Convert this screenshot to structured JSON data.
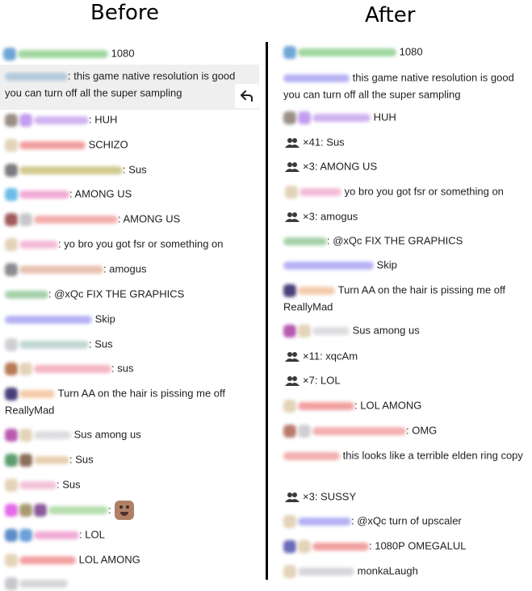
{
  "headings": {
    "before": "Before",
    "after": "After"
  },
  "colors": {
    "highlight": "#efefef",
    "divider": "#000000"
  },
  "icons": {
    "reply": "reply-arrow-icon",
    "group": "chatters-group-icon",
    "emote": "emote-face-icon"
  },
  "before": {
    "messages": [
      {
        "text": "1080"
      },
      {
        "text": ": this game native resolution is good you can turn off all the super sampling"
      },
      {
        "text": ": HUH"
      },
      {
        "text": "SCHIZO"
      },
      {
        "text": ": Sus"
      },
      {
        "text": ": AMONG US"
      },
      {
        "text": ": AMONG US"
      },
      {
        "text": ": yo bro you got fsr or something on"
      },
      {
        "text": ": amogus"
      },
      {
        "text": ": @xQc FIX THE GRAPHICS"
      },
      {
        "text": "Skip"
      },
      {
        "text": ": Sus"
      },
      {
        "text": ": sus"
      },
      {
        "text": "Turn AA on the hair is pissing me off ReallyMad"
      },
      {
        "text": "Sus among us"
      },
      {
        "text": ": Sus"
      },
      {
        "text": ": Sus"
      },
      {
        "text": ":"
      },
      {
        "text": ": LOL"
      },
      {
        "text": "LOL AMONG"
      }
    ]
  },
  "after": {
    "messages": [
      {
        "text": "1080"
      },
      {
        "text": "this game native resolution is good you can turn off all the super sampling"
      },
      {
        "text": "HUH"
      },
      {
        "text": "×41: Sus"
      },
      {
        "text": "×3: AMONG US"
      },
      {
        "text": "yo bro you got fsr or something on"
      },
      {
        "text": "×3: amogus"
      },
      {
        "text": ": @xQc FIX THE GRAPHICS"
      },
      {
        "text": "Skip"
      },
      {
        "text": "Turn AA on the hair is pissing me off ReallyMad"
      },
      {
        "text": "Sus among us"
      },
      {
        "text": "×11: xqcAm"
      },
      {
        "text": "×7: LOL"
      },
      {
        "text": ": LOL AMONG"
      },
      {
        "text": ": OMG"
      },
      {
        "text": "this looks like a terrible elden ring copy"
      },
      {
        "text": "×3: SUSSY"
      },
      {
        "text": ": @xQc turn of upscaler"
      },
      {
        "text": ": 1080P OMEGALUL"
      },
      {
        "text": "monkaLaugh"
      }
    ]
  }
}
